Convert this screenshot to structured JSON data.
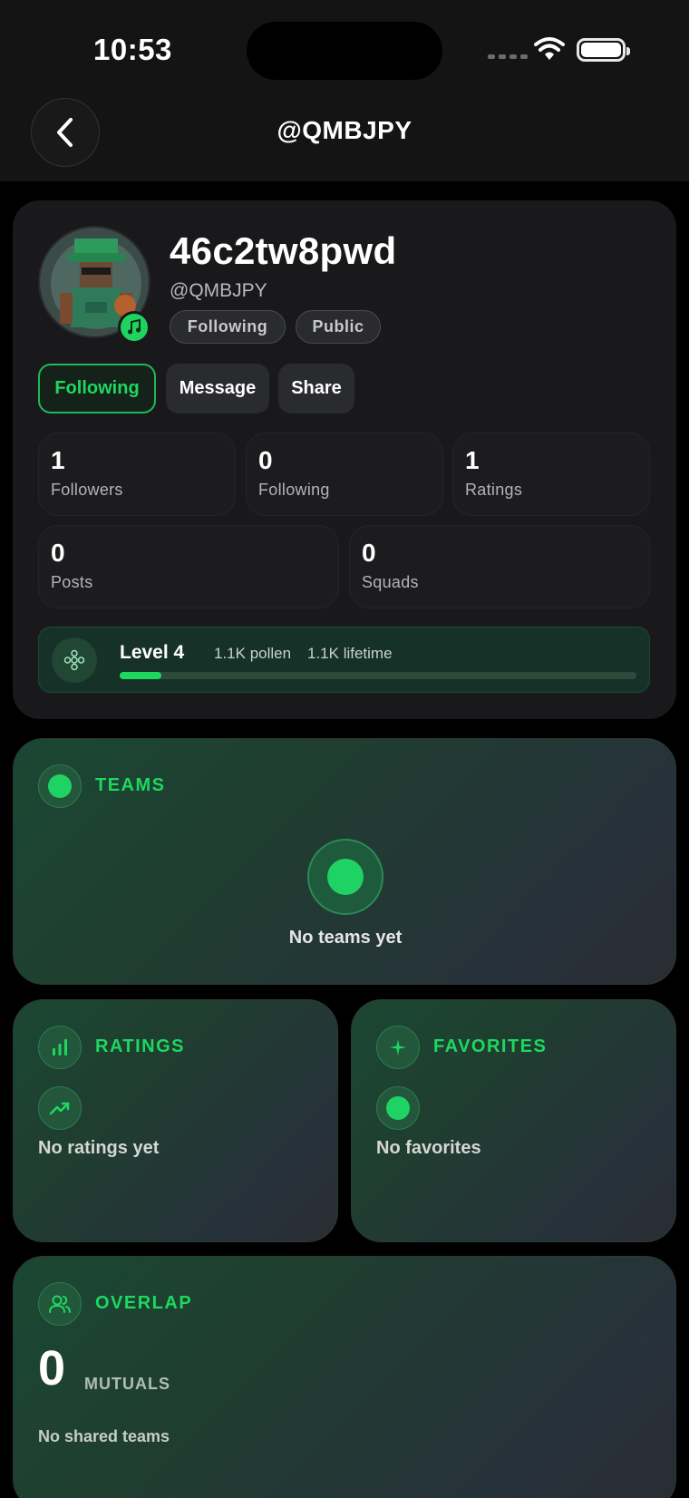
{
  "status_bar": {
    "time": "10:53"
  },
  "header": {
    "title": "@QMBJPY"
  },
  "profile": {
    "display_name": "46c2tw8pwd",
    "handle": "@QMBJPY",
    "chips": [
      "Following",
      "Public"
    ],
    "actions": {
      "following": "Following",
      "message": "Message",
      "share": "Share"
    },
    "stats": [
      {
        "value": "1",
        "label": "Followers"
      },
      {
        "value": "0",
        "label": "Following"
      },
      {
        "value": "1",
        "label": "Ratings"
      },
      {
        "value": "0",
        "label": "Posts"
      },
      {
        "value": "0",
        "label": "Squads"
      }
    ],
    "level": {
      "title": "Level 4",
      "pollen": "1.1K pollen",
      "lifetime": "1.1K lifetime",
      "progress_fraction": 0.08
    }
  },
  "sections": {
    "teams": {
      "title": "TEAMS",
      "empty": "No teams yet"
    },
    "ratings": {
      "title": "RATINGS",
      "empty": "No ratings yet"
    },
    "favorites": {
      "title": "FAVORITES",
      "empty": "No favorites"
    },
    "overlap": {
      "title": "OVERLAP",
      "mutuals_count": "0",
      "mutuals_label": "MUTUALS",
      "shared": "No shared teams"
    }
  },
  "colors": {
    "accent": "#1ed760",
    "card": "#19191b",
    "background": "#000000"
  },
  "icons": [
    "chevron-left-icon",
    "wifi-icon",
    "battery-icon",
    "music-note-icon",
    "flower-icon",
    "bar-chart-icon",
    "trending-up-icon",
    "sparkle-icon",
    "users-icon"
  ]
}
